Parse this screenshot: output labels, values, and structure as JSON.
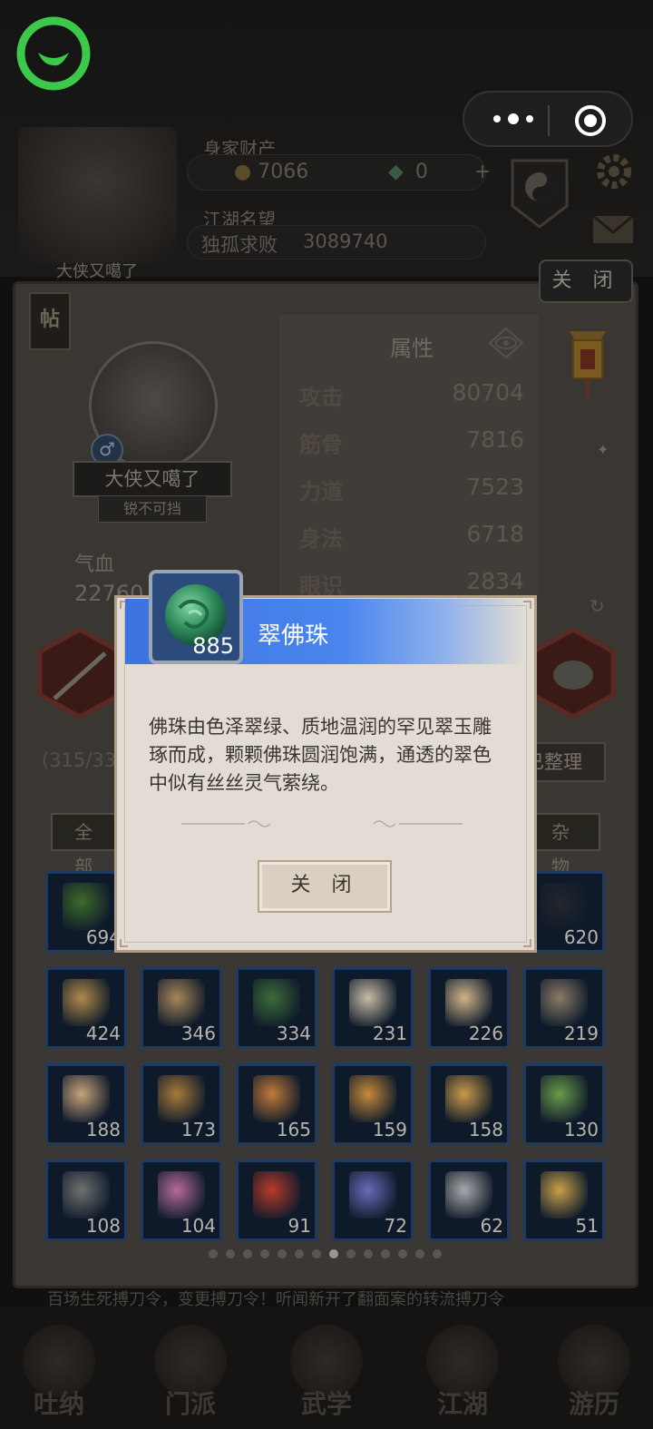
{
  "hud": {
    "wealth_label": "身家财产",
    "gold": "7066",
    "jade": "0",
    "fame_label": "江湖名望",
    "fame_title": "独孤求败",
    "fame_value": "3089740",
    "hero_name": "大侠又噶了"
  },
  "panel": {
    "close_label": "关 闭",
    "post_icon_label": "帖",
    "character": {
      "name": "大侠又噶了",
      "title": "锐不可挡",
      "hp_label": "气血",
      "hp_value": "22760"
    },
    "attributes": {
      "title": "属性",
      "rows": [
        {
          "label": "攻击",
          "value": "80704"
        },
        {
          "label": "筋骨",
          "value": "7816"
        },
        {
          "label": "力道",
          "value": "7523"
        },
        {
          "label": "身法",
          "value": "6718"
        },
        {
          "label": "眼识",
          "value": "2834"
        }
      ]
    },
    "bag_count": "(315/33",
    "sorted_label": "已整理",
    "tab_all": "全 部",
    "tab_misc": "杂 物",
    "inventory": [
      {
        "count": "694",
        "icon": "herb-leaf-icon",
        "color": "#3e6a2a"
      },
      {
        "count": "620",
        "icon": "black-crystal-icon",
        "color": "#23262c"
      },
      {
        "count": "424",
        "icon": "scroll-paper-icon",
        "color": "#b08a4a"
      },
      {
        "count": "346",
        "icon": "map-paper-icon",
        "color": "#a88658"
      },
      {
        "count": "334",
        "icon": "green-herb-icon",
        "color": "#3d6b3a"
      },
      {
        "count": "231",
        "icon": "letter-document-icon",
        "color": "#c8bca4"
      },
      {
        "count": "226",
        "icon": "book-icon",
        "color": "#d0b48a"
      },
      {
        "count": "219",
        "icon": "bracelet-icon",
        "color": "#8a7a66"
      },
      {
        "count": "188",
        "icon": "cloth-roll-icon",
        "color": "#c8a27a"
      },
      {
        "count": "173",
        "icon": "gear-wheel-icon",
        "color": "#a57a3a"
      },
      {
        "count": "165",
        "icon": "money-pouch-icon",
        "color": "#c07a3a"
      },
      {
        "count": "159",
        "icon": "red-envelope-icon",
        "color": "#c58a3a"
      },
      {
        "count": "158",
        "icon": "horn-icon",
        "color": "#c99a4a"
      },
      {
        "count": "130",
        "icon": "bamboo-icon",
        "color": "#6a9a4a"
      },
      {
        "count": "108",
        "icon": "blade-fragment-icon",
        "color": "#707070"
      },
      {
        "count": "104",
        "icon": "silk-roll-icon",
        "color": "#b56a9a"
      },
      {
        "count": "91",
        "icon": "firecracker-icon",
        "color": "#b83a2a"
      },
      {
        "count": "72",
        "icon": "flower-cloth-icon",
        "color": "#6a6ab8"
      },
      {
        "count": "62",
        "icon": "rouge-box-icon",
        "color": "#a8a8a8"
      },
      {
        "count": "51",
        "icon": "coin-icon",
        "color": "#c8a04a"
      }
    ],
    "hint": "百场生死搏刀令，变更搏刀令！听闻新开了翻面案的转流搏刀令"
  },
  "dialog": {
    "item_name": "翠佛珠",
    "item_qty": "885",
    "description": "佛珠由色泽翠绿、质地温润的罕见翠玉雕琢而成，颗颗佛珠圆润饱满，通透的翠色中似有丝丝灵气萦绕。",
    "close_label": "关 闭"
  },
  "bottom_nav": [
    {
      "label": "吐纳"
    },
    {
      "label": "门派"
    },
    {
      "label": "武学"
    },
    {
      "label": "江湖"
    },
    {
      "label": "游历"
    }
  ],
  "pager": {
    "total": 14,
    "active": 7
  },
  "colors": {
    "wechat_green": "#3cc94a",
    "dialog_header_blue": "#3d73e0",
    "slot_border_blue": "#1f3a60"
  }
}
